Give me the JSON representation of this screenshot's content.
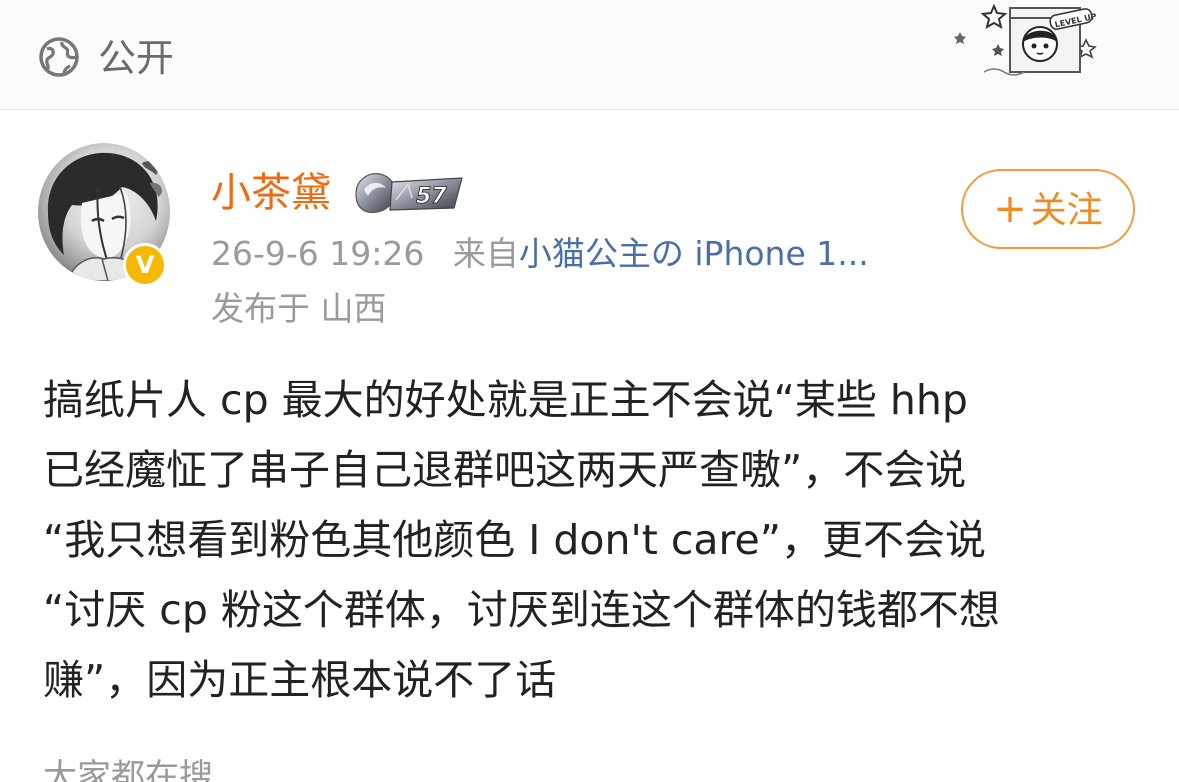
{
  "visibility": {
    "icon": "globe-icon",
    "label": "公开"
  },
  "decoration": {
    "sticker": "LEVEL UP"
  },
  "author": {
    "name": "小茶黛",
    "verified_badge": "V",
    "medal_level": "57",
    "timestamp": "26-9-6 19:26",
    "from_label": "来自",
    "device": "小猫公主の iPhone 1...",
    "location": "发布于 山西"
  },
  "follow_button": {
    "icon": "+",
    "label": "关注"
  },
  "post": {
    "lines": [
      "搞纸片人 cp 最大的好处就是正主不会说“某些 hhp",
      "已经魔怔了串子自己退群吧这两天严查嗷”，不会说",
      "“我只想看到粉色其他颜色 I don't care”，更不会说",
      "“讨厌 cp 粉这个群体，讨厌到连这个群体的钱都不想",
      "赚”，因为正主根本说不了话"
    ]
  },
  "footer": {
    "trending_label": "大家都在搜"
  },
  "colors": {
    "username": "#f0680f",
    "follow": "#f08a24",
    "device_link": "#4a6fa8",
    "badge": "#f6b800"
  }
}
